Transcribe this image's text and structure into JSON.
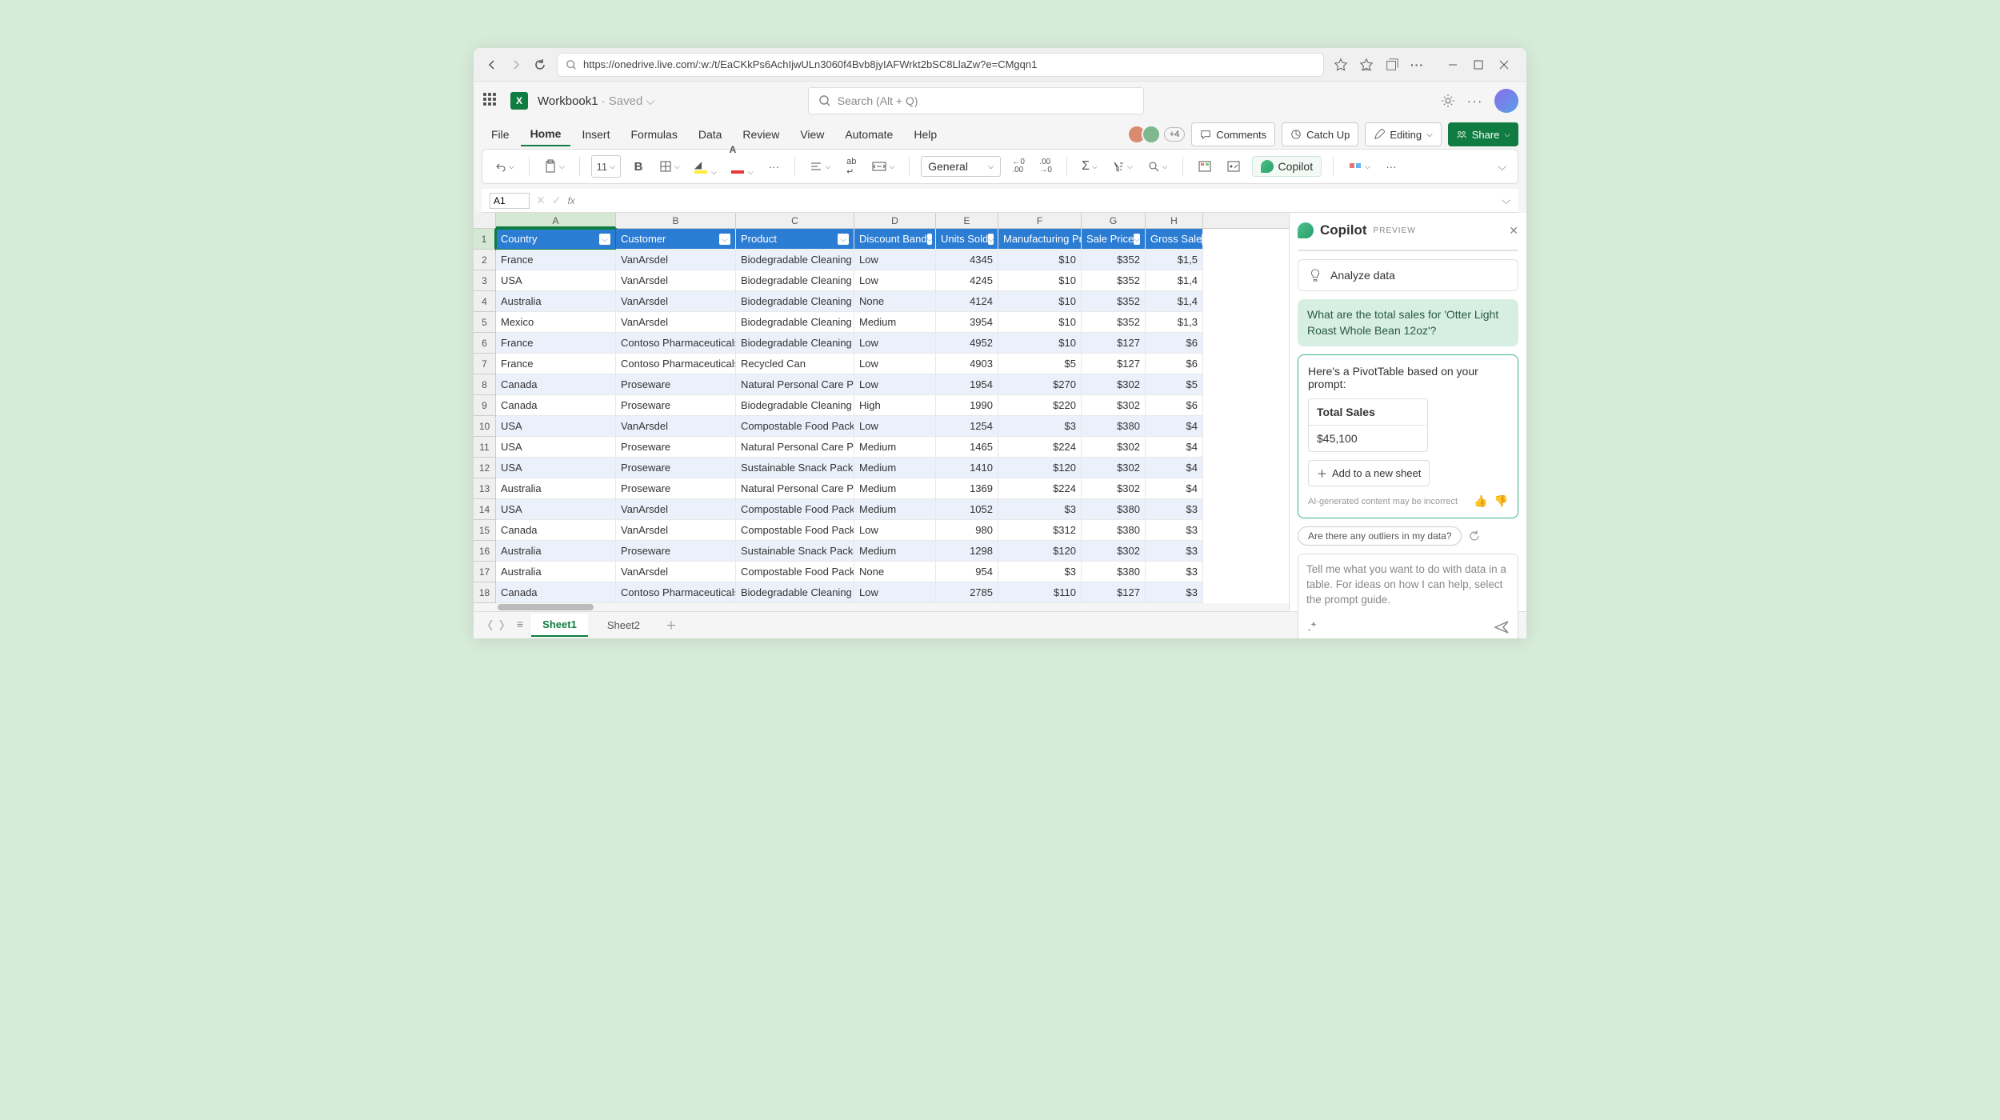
{
  "browser": {
    "url": "https://onedrive.live.com/:w:/t/EaCKkPs6AchIjwULn3060f4Bvb8jyIAFWrkt2bSC8LlaZw?e=CMgqn1"
  },
  "app": {
    "name": "X",
    "doc_name": "Workbook1",
    "doc_status": "· Saved",
    "search_placeholder": "Search (Alt + Q)",
    "presence_count": "+4"
  },
  "tabs": {
    "file": "File",
    "home": "Home",
    "insert": "Insert",
    "formulas": "Formulas",
    "data": "Data",
    "review": "Review",
    "view": "View",
    "automate": "Automate",
    "help": "Help",
    "comments": "Comments",
    "catchup": "Catch Up",
    "editing": "Editing",
    "share": "Share"
  },
  "toolbar": {
    "font_size": "11",
    "number_format": "General",
    "copilot": "Copilot"
  },
  "formula": {
    "name_box": "A1"
  },
  "columns": [
    "A",
    "B",
    "C",
    "D",
    "E",
    "F",
    "G",
    "H"
  ],
  "headers": [
    "Country",
    "Customer",
    "Product",
    "Discount Band",
    "Units Sold",
    "Manufacturing Price",
    "Sale Price",
    "Gross Sale"
  ],
  "rows": [
    {
      "n": 2,
      "d": [
        "France",
        "VanArsdel",
        "Biodegradable Cleaning Products",
        "Low",
        "4345",
        "$10",
        "$352",
        "$1,5"
      ]
    },
    {
      "n": 3,
      "d": [
        "USA",
        "VanArsdel",
        "Biodegradable Cleaning Products",
        "Low",
        "4245",
        "$10",
        "$352",
        "$1,4"
      ]
    },
    {
      "n": 4,
      "d": [
        "Australia",
        "VanArsdel",
        "Biodegradable Cleaning Products",
        "None",
        "4124",
        "$10",
        "$352",
        "$1,4"
      ]
    },
    {
      "n": 5,
      "d": [
        "Mexico",
        "VanArsdel",
        "Biodegradable Cleaning Products",
        "Medium",
        "3954",
        "$10",
        "$352",
        "$1,3"
      ]
    },
    {
      "n": 6,
      "d": [
        "France",
        "Contoso Pharmaceuticals",
        "Biodegradable Cleaning Products",
        "Low",
        "4952",
        "$10",
        "$127",
        "$6"
      ]
    },
    {
      "n": 7,
      "d": [
        "France",
        "Contoso Pharmaceuticals",
        "Recycled Can",
        "Low",
        "4903",
        "$5",
        "$127",
        "$6"
      ]
    },
    {
      "n": 8,
      "d": [
        "Canada",
        "Proseware",
        "Natural Personal Care Products",
        "Low",
        "1954",
        "$270",
        "$302",
        "$5"
      ]
    },
    {
      "n": 9,
      "d": [
        "Canada",
        "Proseware",
        "Biodegradable Cleaning Products",
        "High",
        "1990",
        "$220",
        "$302",
        "$6"
      ]
    },
    {
      "n": 10,
      "d": [
        "USA",
        "VanArsdel",
        "Compostable Food Packaging",
        "Low",
        "1254",
        "$3",
        "$380",
        "$4"
      ]
    },
    {
      "n": 11,
      "d": [
        "USA",
        "Proseware",
        "Natural Personal Care Products",
        "Medium",
        "1465",
        "$224",
        "$302",
        "$4"
      ]
    },
    {
      "n": 12,
      "d": [
        "USA",
        "Proseware",
        "Sustainable Snack Packaging",
        "Medium",
        "1410",
        "$120",
        "$302",
        "$4"
      ]
    },
    {
      "n": 13,
      "d": [
        "Australia",
        "Proseware",
        "Natural Personal Care Products",
        "Medium",
        "1369",
        "$224",
        "$302",
        "$4"
      ]
    },
    {
      "n": 14,
      "d": [
        "USA",
        "VanArsdel",
        "Compostable Food Packaging",
        "Medium",
        "1052",
        "$3",
        "$380",
        "$3"
      ]
    },
    {
      "n": 15,
      "d": [
        "Canada",
        "VanArsdel",
        "Compostable Food Packaging",
        "Low",
        "980",
        "$312",
        "$380",
        "$3"
      ]
    },
    {
      "n": 16,
      "d": [
        "Australia",
        "Proseware",
        "Sustainable Snack Packaging",
        "Medium",
        "1298",
        "$120",
        "$302",
        "$3"
      ]
    },
    {
      "n": 17,
      "d": [
        "Australia",
        "VanArsdel",
        "Compostable Food Packaging",
        "None",
        "954",
        "$3",
        "$380",
        "$3"
      ]
    },
    {
      "n": 18,
      "d": [
        "Canada",
        "Contoso Pharmaceuticals",
        "Biodegradable Cleaning Products",
        "Low",
        "2785",
        "$110",
        "$127",
        "$3"
      ]
    }
  ],
  "copilot": {
    "title": "Copilot",
    "badge": "PREVIEW",
    "analyze": "Analyze data",
    "user_message": "What are the total sales for 'Otter Light Roast Whole Bean 12oz'?",
    "assistant_intro": "Here's a PivotTable based on your prompt:",
    "pivot_header": "Total Sales",
    "pivot_value": "$45,100",
    "add_sheet": "Add to a new sheet",
    "disclaimer": "AI-generated content may be incorrect",
    "suggestion": "Are there any outliers in my data?",
    "placeholder": "Tell me what you want to do with data in a table. For ideas on how I can help, select the prompt guide."
  },
  "sheets": {
    "s1": "Sheet1",
    "s2": "Sheet2"
  }
}
